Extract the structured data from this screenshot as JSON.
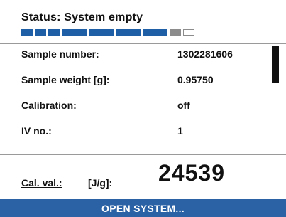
{
  "status": {
    "text": "Status: System empty",
    "progress_segments": [
      "filled",
      "filled",
      "filled",
      "filled",
      "filled",
      "filled",
      "filled",
      "gray",
      "empty"
    ]
  },
  "rows": [
    {
      "label": "Sample number:",
      "value": "1302281606"
    },
    {
      "label": "Sample weight [g]:",
      "value": "0.95750"
    },
    {
      "label": "Calibration:",
      "value": "off"
    },
    {
      "label": "IV no.:",
      "value": "1"
    }
  ],
  "calibration_value": {
    "label": "Cal. val.:",
    "unit": "[J/g]:",
    "value": "24539"
  },
  "softkey": {
    "label": "OPEN SYSTEM..."
  },
  "colors": {
    "accent": "#2b62a5",
    "progress_filled": "#1f5fa6",
    "progress_gray": "#8c8c8c"
  }
}
